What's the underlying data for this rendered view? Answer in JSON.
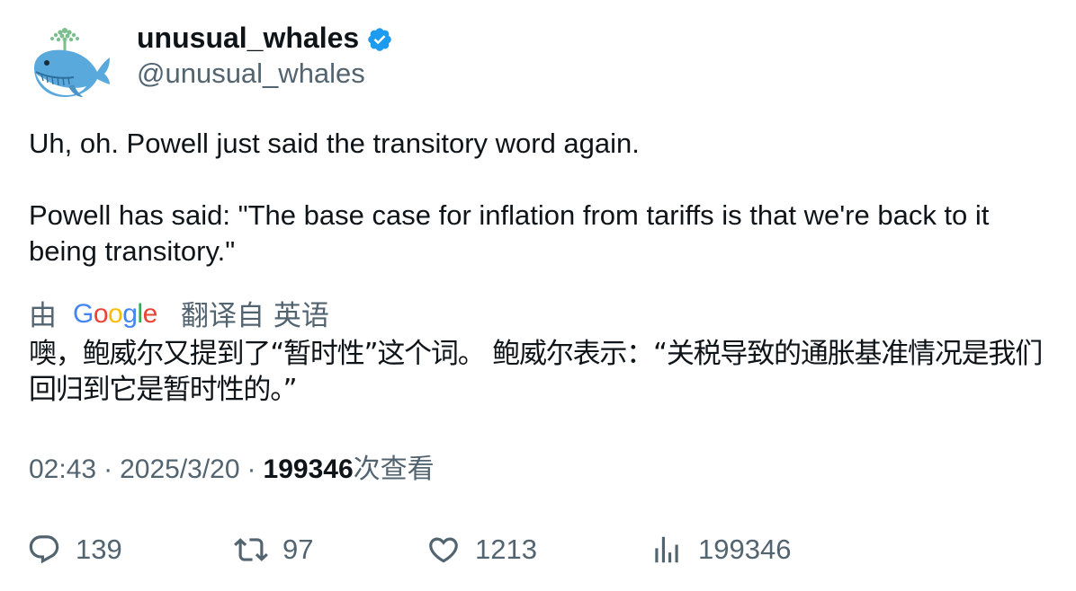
{
  "author": {
    "display_name": "unusual_whales",
    "handle": "@unusual_whales",
    "avatar_icon": "whale-avatar-icon",
    "verified_icon": "verified-badge-icon",
    "verified_color": "#1d9bf0"
  },
  "tweet": {
    "paragraphs": [
      "Uh, oh. Powell just said the transitory word again.",
      "Powell has said: \"The base case for inflation from tariffs is that we're back to it being transitory.\""
    ]
  },
  "translation": {
    "by_label": "由",
    "provider_logo": "Google",
    "from_label": "翻译自 英语",
    "text": "噢，鲍威尔又提到了“暂时性”这个词。 鲍威尔表示：“关税导致的通胀基准情况是我们回归到它是暂时性的。”"
  },
  "meta": {
    "time": "02:43",
    "dot1": "·",
    "date": "2025/3/20",
    "dot2": "·",
    "views_count": "199346",
    "views_label": "次查看"
  },
  "actions": {
    "replies": "139",
    "retweets": "97",
    "likes": "1213",
    "views": "199346"
  },
  "colors": {
    "text_primary": "#0f1419",
    "text_secondary": "#536471",
    "accent": "#1d9bf0"
  }
}
